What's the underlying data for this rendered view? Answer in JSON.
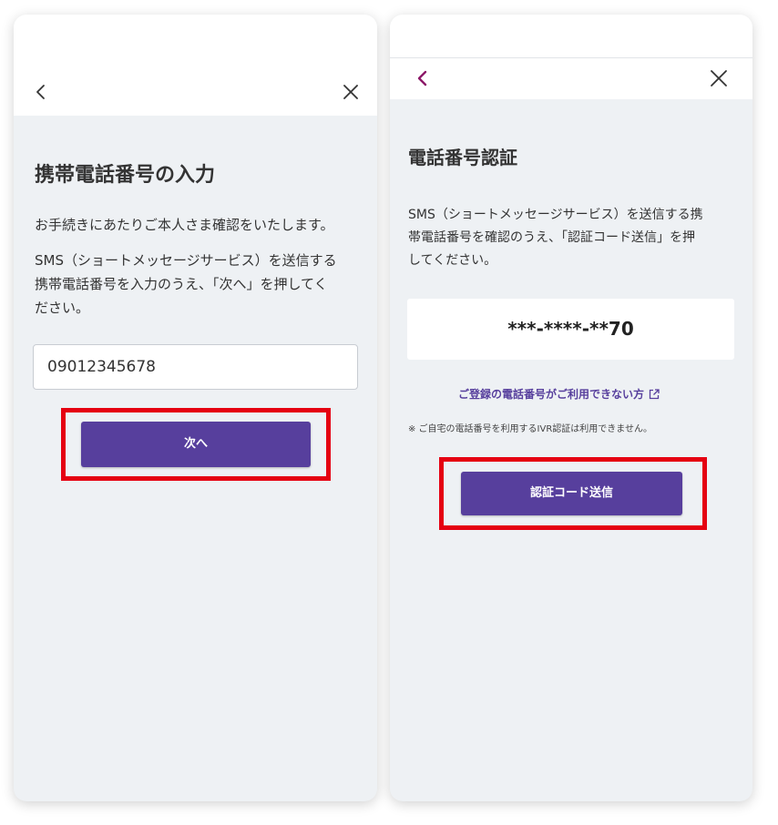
{
  "left_screen": {
    "title": "携帯電話番号の入力",
    "intro": "お手続きにあたりご本人さま確認をいたします。",
    "instruction_line1": "SMS（ショートメッセージサービス）を送信する",
    "instruction_line2": "携帯電話番号を入力のうえ、「次へ」を押してく",
    "instruction_line3": "ださい。",
    "phone_input_value": "09012345678",
    "next_button_label": "次へ"
  },
  "right_screen": {
    "title": "電話番号認証",
    "instruction_line1": "SMS（ショートメッセージサービス）を送信する携",
    "instruction_line2": "帯電話番号を確認のうえ、「認証コード送信」を押",
    "instruction_line3": "してください。",
    "masked_phone": "***-****-**70",
    "unavailable_link": "ご登録の電話番号がご利用できない方",
    "note": "※ ご自宅の電話番号を利用するIVR認証は利用できません。",
    "send_code_button_label": "認証コード送信"
  },
  "icons": {
    "back": "chevron-left-icon",
    "close": "close-icon",
    "external": "external-link-icon"
  },
  "colors": {
    "brand_purple": "#573f9d",
    "back_chevron_accent": "#8c1868",
    "highlight_red": "#e50011",
    "panel_background": "#eef1f4"
  }
}
